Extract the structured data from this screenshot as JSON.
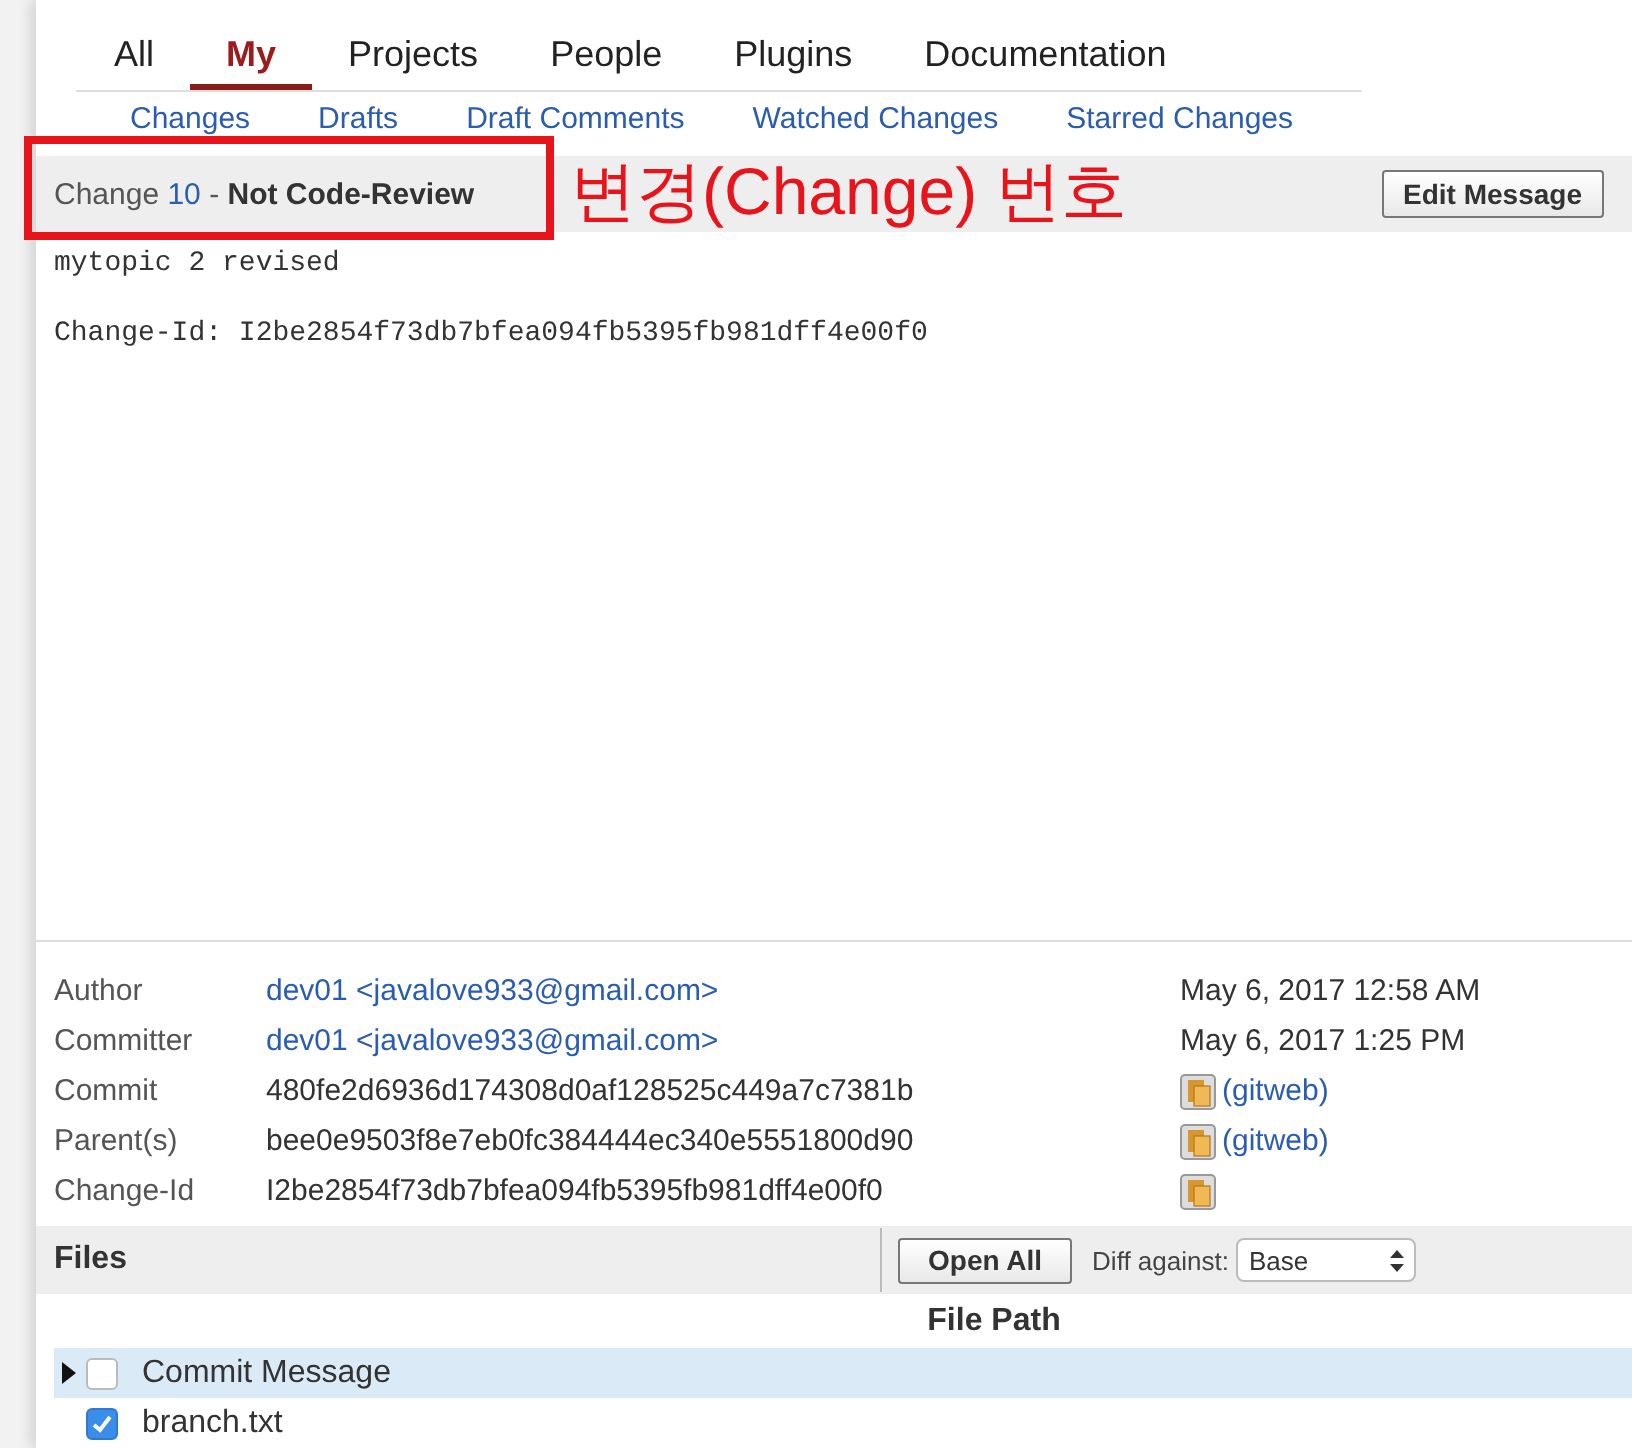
{
  "nav": {
    "tabs": [
      {
        "label": "All",
        "selected": false
      },
      {
        "label": "My",
        "selected": true
      },
      {
        "label": "Projects",
        "selected": false
      },
      {
        "label": "People",
        "selected": false
      },
      {
        "label": "Plugins",
        "selected": false
      },
      {
        "label": "Documentation",
        "selected": false
      }
    ],
    "subtabs": [
      "Changes",
      "Drafts",
      "Draft Comments",
      "Watched Changes",
      "Starred Changes"
    ]
  },
  "change_header": {
    "prefix": "Change",
    "number": "10",
    "separator": "-",
    "status": "Not Code-Review",
    "button": "Edit Message"
  },
  "annotation": {
    "text": "변경(Change) 번호"
  },
  "commit_message": {
    "subject": "mytopic 2 revised",
    "change_id_line": "Change-Id: I2be2854f73db7bfea094fb5395fb981dff4e00f0"
  },
  "info": [
    {
      "label": "Author",
      "value": "dev01 <javalove933@gmail.com>",
      "kind": "link",
      "date": "May 6, 2017 12:58 AM"
    },
    {
      "label": "Committer",
      "value": "dev01 <javalove933@gmail.com>",
      "kind": "link",
      "date": "May 6, 2017 1:25 PM"
    },
    {
      "label": "Commit",
      "value": "480fe2d6936d174308d0af128525c449a7c7381b",
      "kind": "hash",
      "gitweb": "(gitweb)"
    },
    {
      "label": "Parent(s)",
      "value": "bee0e9503f8e7eb0fc384444ec340e5551800d90",
      "kind": "hash",
      "gitweb": "(gitweb)"
    },
    {
      "label": "Change-Id",
      "value": "I2be2854f73db7bfea094fb5395fb981dff4e00f0",
      "kind": "hash"
    }
  ],
  "files": {
    "title": "Files",
    "open_all": "Open All",
    "diff_label": "Diff against:",
    "diff_value": "Base",
    "column": "File Path",
    "rows": [
      {
        "name": "Commit Message",
        "checked": false,
        "selected": true,
        "expandable": true
      },
      {
        "name": "branch.txt",
        "checked": true,
        "selected": false,
        "expandable": false
      }
    ]
  }
}
